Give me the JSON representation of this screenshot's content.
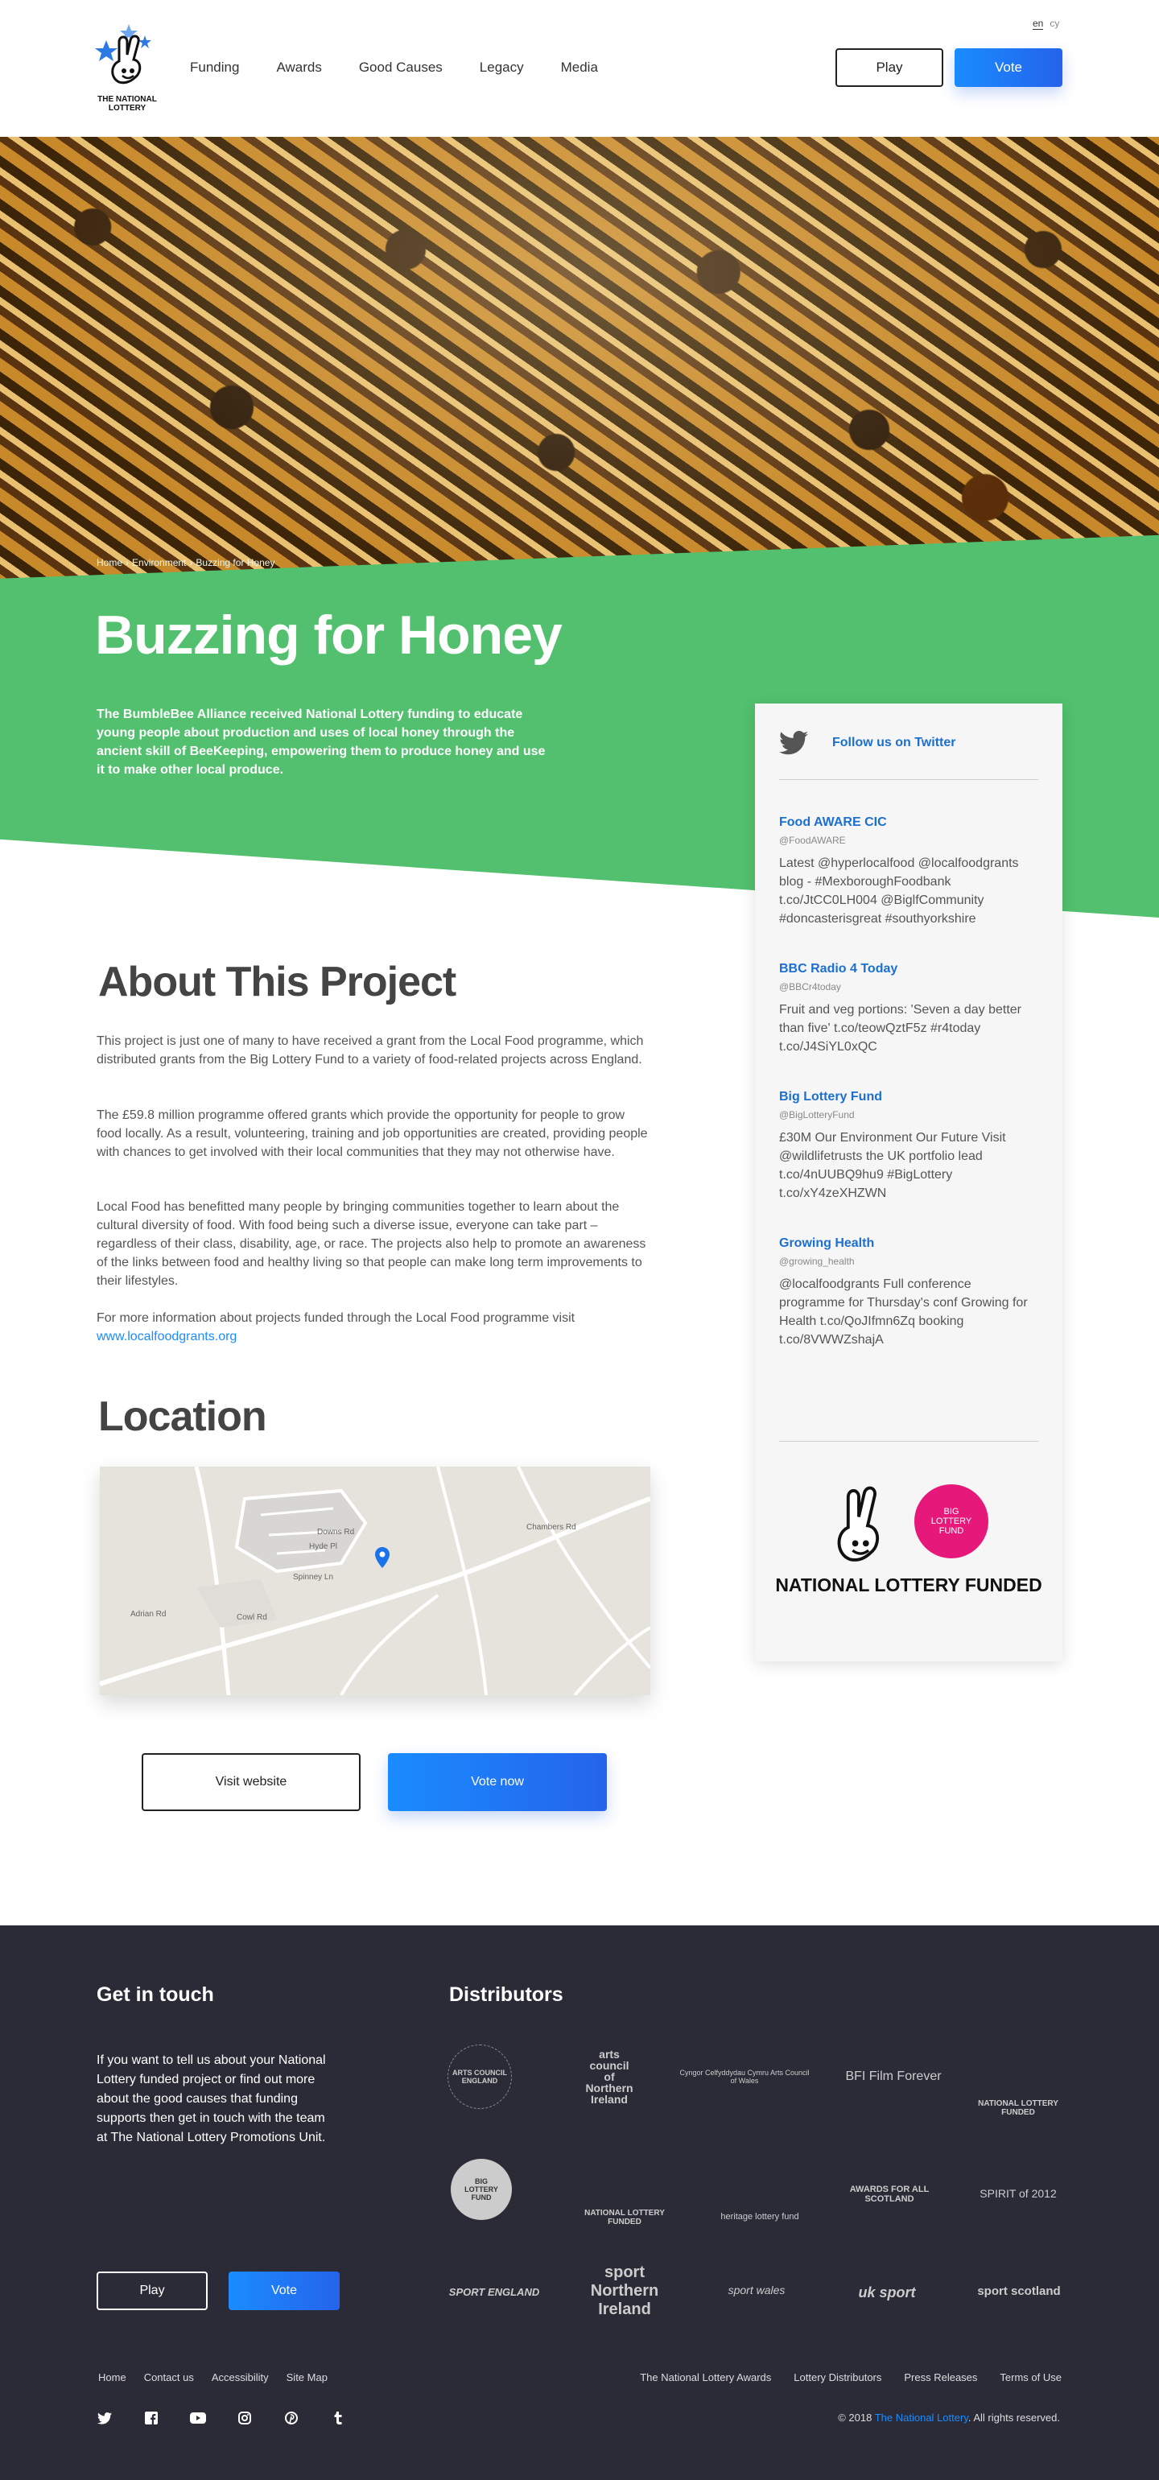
{
  "header": {
    "logo_text": "THE NATIONAL LOTTERY",
    "nav": [
      "Funding",
      "Awards",
      "Good Causes",
      "Legacy",
      "Media"
    ],
    "lang": [
      "en",
      "cy"
    ],
    "play_label": "Play",
    "vote_label": "Vote"
  },
  "breadcrumb": [
    "Home",
    "Environment",
    "Buzzing for Honey"
  ],
  "page_title": "Buzzing for Honey",
  "intro": "The BumbleBee Alliance received National Lottery funding to educate young people about production and uses of local honey through the ancient skill of BeeKeeping, empowering them to produce honey and use it to make other local produce.",
  "about": {
    "title": "About This Project",
    "paragraphs": [
      "This project is just one of many to have received a grant from the Local Food programme, which distributed grants from the Big Lottery Fund to a variety of food-related projects across England.",
      "The £59.8 million programme offered grants which provide the opportunity for people to grow food locally. As a result, volunteering, training and job opportunities are created, providing people with chances to get involved with their local communities that they may not otherwise have.",
      "Local Food has benefitted many people by bringing communities together to learn about the cultural diversity of food. With food being such a diverse issue, everyone can take part – regardless of their class, disability, age, or race. The projects also help to promote an awareness of the links between food and healthy living so that people can make long term improvements to their lifestyles."
    ],
    "more_text": "For more information about projects funded through the Local Food programme visit",
    "more_link": "www.localfoodgrants.org"
  },
  "location": {
    "title": "Location",
    "map_labels": [
      "Downs Rd",
      "Hyde Pl",
      "Spinney Ln",
      "Adrian Rd",
      "Cowl Rd",
      "Chambers Rd"
    ]
  },
  "actions": {
    "visit_label": "Visit website",
    "vote_now_label": "Vote now"
  },
  "twitter": {
    "follow_label": "Follow us on Twitter",
    "tweets": [
      {
        "name": "Food AWARE CIC",
        "handle": "@FoodAWARE",
        "text": "Latest @hyperlocalfood @localfoodgrants blog - #MexboroughFoodbank t.co/JtCC0LH004 @BiglfCommunity #doncasterisgreat #southyorkshire"
      },
      {
        "name": "BBC Radio 4 Today",
        "handle": "@BBCr4today",
        "text": "Fruit and veg portions: 'Seven a day better than five' t.co/teowQztF5z #r4today t.co/J4SiYL0xQC"
      },
      {
        "name": "Big Lottery Fund",
        "handle": "@BigLotteryFund",
        "text": "£30M Our Environment Our Future Visit @wildlifetrusts the UK portfolio lead t.co/4nUUBQ9hu9 #BigLottery t.co/xY4zeXHZWN"
      },
      {
        "name": "Growing Health",
        "handle": "@growing_health",
        "text": "@localfoodgrants Full conference programme for Thursday's conf Growing for Health t.co/QoJIfmn6Zq booking t.co/8VWWZshajA"
      }
    ],
    "funded_badge": "BIG LOTTERY FUND",
    "funded_text": "NATIONAL LOTTERY FUNDED"
  },
  "footer": {
    "get_in_touch_title": "Get in touch",
    "get_in_touch_text": "If you want to tell us about your National Lottery funded project or find out more about the good causes that funding supports then get in touch with the team at The National Lottery Promotions Unit.",
    "play_label": "Play",
    "vote_label": "Vote",
    "distributors_title": "Distributors",
    "distributors": [
      "ARTS COUNCIL ENGLAND",
      "arts council of Northern Ireland",
      "Cyngor Celfyddydau Cymru Arts Council of Wales",
      "BFI Film Forever",
      "NATIONAL LOTTERY FUNDED",
      "BIG LOTTERY FUND",
      "NATIONAL LOTTERY FUNDED",
      "heritage lottery fund",
      "AWARDS FOR ALL SCOTLAND",
      "SPIRIT of 2012",
      "SPORT ENGLAND",
      "sport Northern Ireland",
      "sport wales",
      "uk sport",
      "sport scotland"
    ],
    "links_left": [
      "Home",
      "Contact us",
      "Accessibility",
      "Site Map"
    ],
    "links_right": [
      "The National Lottery Awards",
      "Lottery Distributors",
      "Press Releases",
      "Terms of Use"
    ],
    "social": [
      "twitter-icon",
      "facebook-icon",
      "youtube-icon",
      "instagram-icon",
      "pinterest-icon",
      "tumblr-icon"
    ],
    "copyright_prefix": "© 2018",
    "copyright_link": "The National Lottery",
    "copyright_suffix": ". All rights reserved."
  },
  "colors": {
    "accent_blue": "#1a8cff",
    "green": "#52c06e",
    "footer_bg": "#2b2b37",
    "twitter_blue": "#1c6fd1"
  }
}
